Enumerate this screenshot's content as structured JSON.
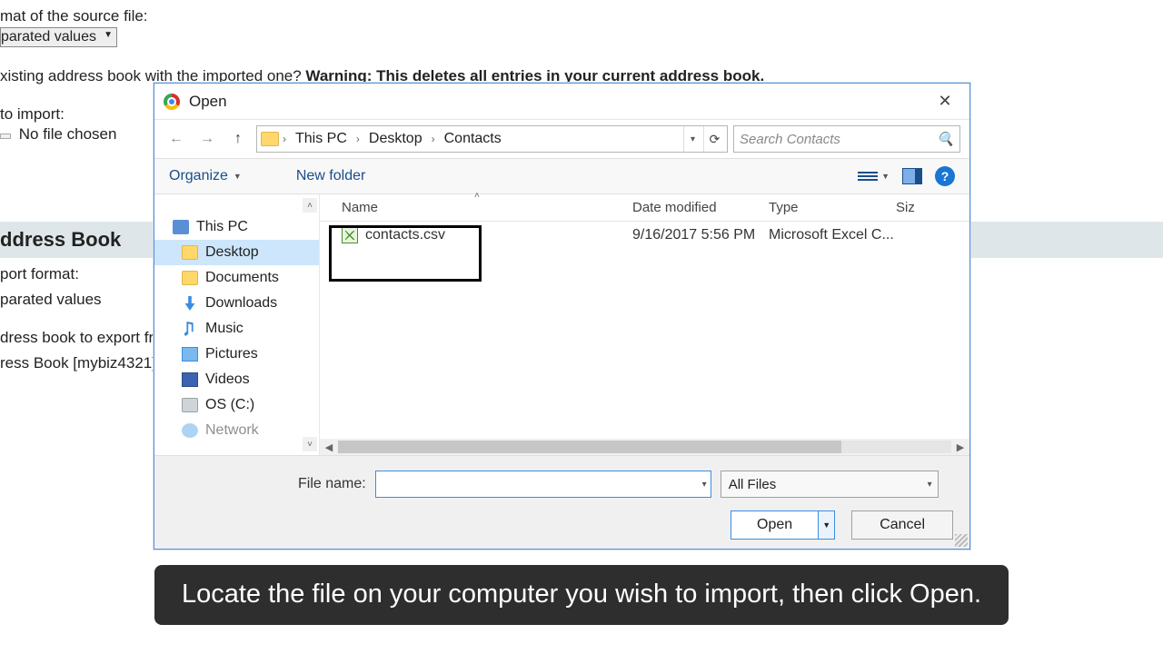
{
  "bg": {
    "format_label": "mat of the source file:",
    "format_value": "parated values",
    "replace_q": "xisting address book with the imported one? ",
    "warning": "Warning: This deletes all entries in your current address book.",
    "import_label": "to import:",
    "choose_file_label": "",
    "no_file": "No file chosen",
    "section_title": "ddress Book",
    "export_format_label": "port format:",
    "export_format_value": "parated values",
    "export_book_label": "dress book to export fro",
    "export_book_value": "ress Book [mybiz4321]"
  },
  "dialog": {
    "title": "Open",
    "path": {
      "root": "This PC",
      "p1": "Desktop",
      "p2": "Contacts"
    },
    "search_placeholder": "Search Contacts",
    "toolbar": {
      "organize": "Organize",
      "newfolder": "New folder"
    },
    "tree": {
      "thispc": "This PC",
      "desktop": "Desktop",
      "documents": "Documents",
      "downloads": "Downloads",
      "music": "Music",
      "pictures": "Pictures",
      "videos": "Videos",
      "drive": "OS (C:)",
      "network_clip": "Network"
    },
    "columns": {
      "name": "Name",
      "date": "Date modified",
      "type": "Type",
      "size": "Siz"
    },
    "file": {
      "name": "contacts.csv",
      "date": "9/16/2017 5:56 PM",
      "type": "Microsoft Excel C..."
    },
    "filename_label": "File name:",
    "filetype": "All Files",
    "open": "Open",
    "cancel": "Cancel"
  },
  "caption": "Locate the file on your computer you wish to import, then click Open."
}
